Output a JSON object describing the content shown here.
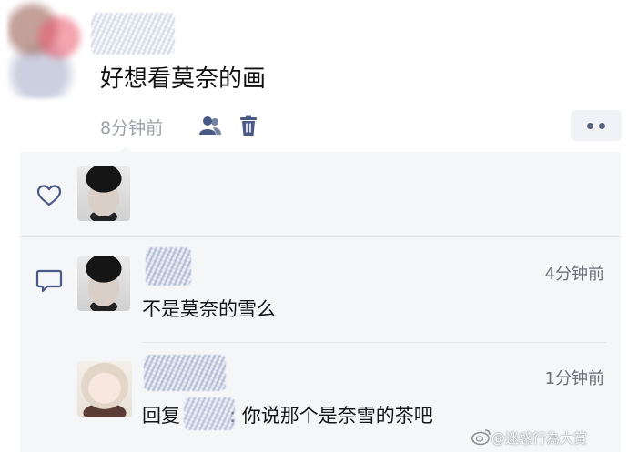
{
  "post": {
    "text": "好想看莫奈的画",
    "time": "8分钟前"
  },
  "comments": [
    {
      "time": "4分钟前",
      "text": "不是莫奈的雪么"
    }
  ],
  "reply": {
    "time": "1分钟前",
    "prefix": "回复",
    "text": ": 你说那个是奈雪的茶吧"
  },
  "watermark": "@迷惑行為大賞",
  "icons": {
    "like": "heart-outline-icon",
    "comment": "comment-icon",
    "visibility": "people-icon",
    "delete": "trash-icon",
    "more": "more-dots-icon",
    "weibo": "weibo-logo-icon"
  },
  "colors": {
    "icon_blue": "#4a5a86",
    "time_gray": "#9a9fa8",
    "panel_bg": "#f5f6f8"
  }
}
